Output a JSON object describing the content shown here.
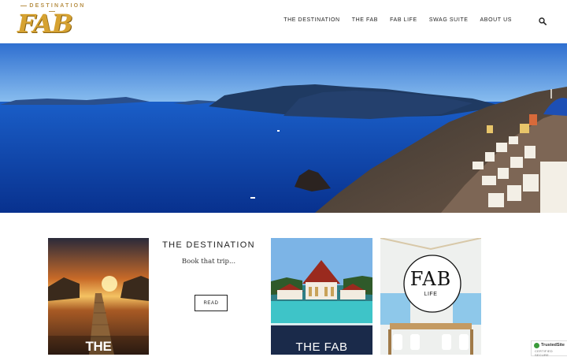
{
  "header": {
    "logo_top": "DESTINATION",
    "logo_main": "FAB",
    "nav": [
      "THE DESTINATION",
      "THE FAB",
      "FAB LIFE",
      "SWAG SUITE",
      "ABOUT US"
    ],
    "search_icon": "search-icon"
  },
  "hero": {
    "image": "santorini-caldera-panorama"
  },
  "feature": {
    "title": "THE DESTINATION",
    "subtitle": "Book that trip...",
    "button": "READ"
  },
  "cards": {
    "card1_overlay": "THE DESTINATION",
    "card3_overlay": "THE FAB",
    "card4_logo_main": "FAB",
    "card4_logo_sub": "LIFE"
  },
  "badge": {
    "line1": "TrustedSite",
    "line2": "CERTIFIED SECURE"
  },
  "colors": {
    "gold": "#d6a231",
    "sea": "#0b3fb0",
    "sky": "#5a9de6",
    "text": "#222222"
  }
}
